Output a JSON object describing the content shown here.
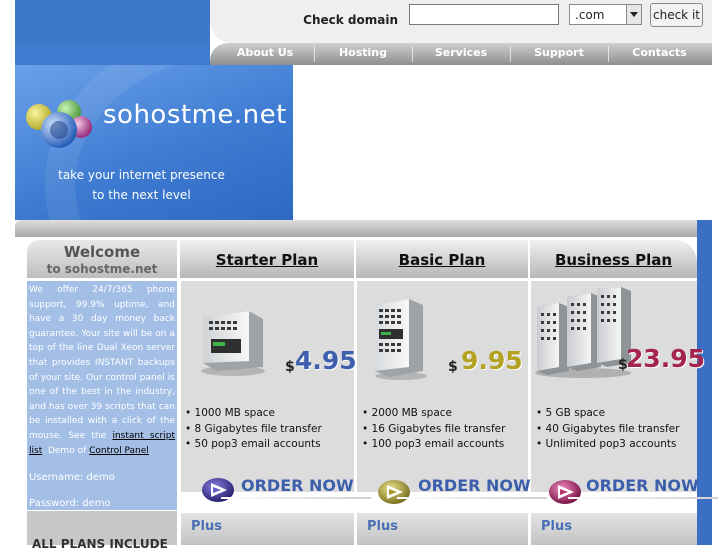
{
  "header": {
    "check_label": "Check domain",
    "domain_value": "",
    "tld_selected": ".com",
    "check_button": "check it"
  },
  "nav": {
    "items": [
      "About Us",
      "Hosting",
      "Services",
      "Support",
      "Contacts"
    ]
  },
  "banner": {
    "logo": "sohostme.net",
    "tagline_line1": "take your internet presence",
    "tagline_line2": "to the next level"
  },
  "sidebar": {
    "welcome": "Welcome",
    "welcome_sub": "to sohostme.net",
    "intro_text": "We offer 24/7/365 phone support, 99.9% uptime, and have a 30 day money back guarantee. Your site will be on a top of the line Dual Xeon server that provides INSTANT backups of your site. Our control panel is one of the best in the industry, and has over 39 scripts that can be installed with a click of the mouse. See the",
    "script_list_link": "instant script list",
    "demo_prefix": "Demo of",
    "control_panel_link": "Control Panel",
    "username": "Username: demo",
    "password": "Password: demo",
    "all_plans": "ALL PLANS INCLUDE"
  },
  "plans": [
    {
      "title": "Starter Plan",
      "dollar": "$",
      "price": "4.95",
      "price_color": "#3d5fae",
      "features": [
        "• 1000 MB space",
        "• 8 Gigabytes file transfer",
        "• 50 pop3 email accounts"
      ],
      "order": "ORDER NOW",
      "plus": "Plus"
    },
    {
      "title": "Basic Plan",
      "dollar": "$",
      "price": "9.95",
      "price_color": "#b2a21f",
      "features": [
        "• 2000 MB space",
        "• 16 Gigabytes file transfer",
        "• 100 pop3 email accounts"
      ],
      "order": "ORDER NOW",
      "plus": "Plus"
    },
    {
      "title": "Business Plan",
      "dollar": "$",
      "price": "23.95",
      "price_color": "#a5234f",
      "features": [
        "• 5 GB space",
        "• 40 Gigabytes file transfer",
        "• Unlimited pop3 accounts"
      ],
      "order": "ORDER NOW",
      "plus": "Plus"
    }
  ],
  "icons": {
    "order_arrow": "order-arrow-icon",
    "logo_circles": "logo-circles-icon",
    "server": "server-icon"
  }
}
